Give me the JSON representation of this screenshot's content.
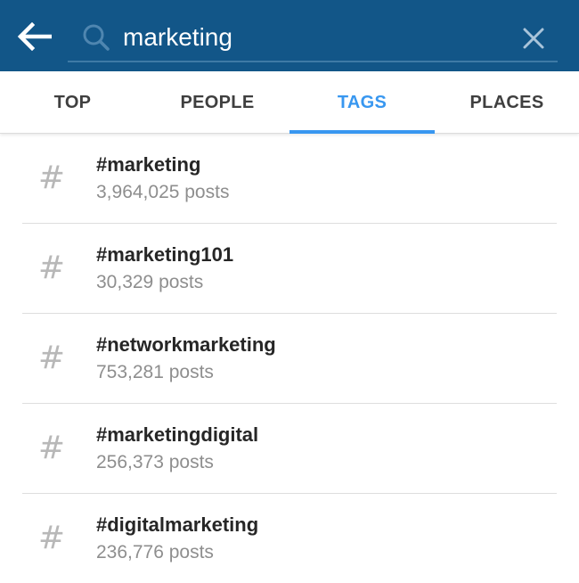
{
  "header": {
    "back_icon": "arrow-left-icon",
    "search_icon": "search-icon",
    "clear_icon": "close-icon",
    "search_value": "marketing",
    "bg_color": "#125688"
  },
  "tabs": [
    {
      "label": "TOP",
      "active": false
    },
    {
      "label": "PEOPLE",
      "active": false
    },
    {
      "label": "TAGS",
      "active": true
    },
    {
      "label": "PLACES",
      "active": false
    }
  ],
  "accent_color": "#3897f0",
  "results": [
    {
      "icon": "#",
      "name": "#marketing",
      "count": "3,964,025 posts"
    },
    {
      "icon": "#",
      "name": "#marketing101",
      "count": "30,329 posts"
    },
    {
      "icon": "#",
      "name": "#networkmarketing",
      "count": "753,281 posts"
    },
    {
      "icon": "#",
      "name": "#marketingdigital",
      "count": "256,373 posts"
    },
    {
      "icon": "#",
      "name": "#digitalmarketing",
      "count": "236,776 posts"
    }
  ]
}
